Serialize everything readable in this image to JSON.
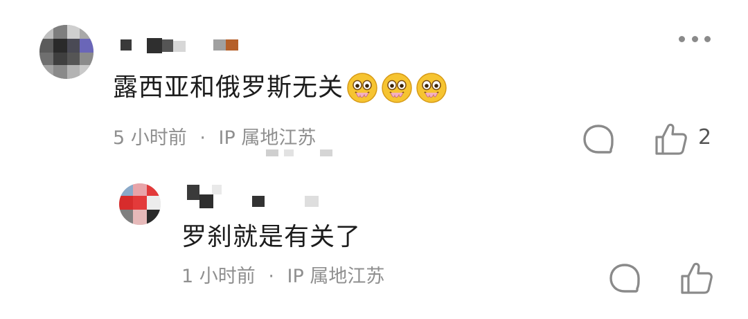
{
  "comments": [
    {
      "content": "露西亚和俄罗斯无关",
      "emoji_name": "drooling-face-emoji",
      "emoji_count": 3,
      "time": "5 小时前",
      "separator": "·",
      "ip_location": "IP 属地江苏",
      "like_count": "2"
    },
    {
      "content": "罗刹就是有关了",
      "time": "1 小时前",
      "separator": "·",
      "ip_location": "IP 属地江苏",
      "like_count": ""
    }
  ],
  "icons": {
    "more": "more-horizontal-icon",
    "reply": "comment-bubble-icon",
    "like": "thumbs-up-icon"
  },
  "colors": {
    "text_primary": "#1c1c1c",
    "text_meta": "#8f8f8f",
    "icon_stroke": "#8a8a8a"
  }
}
